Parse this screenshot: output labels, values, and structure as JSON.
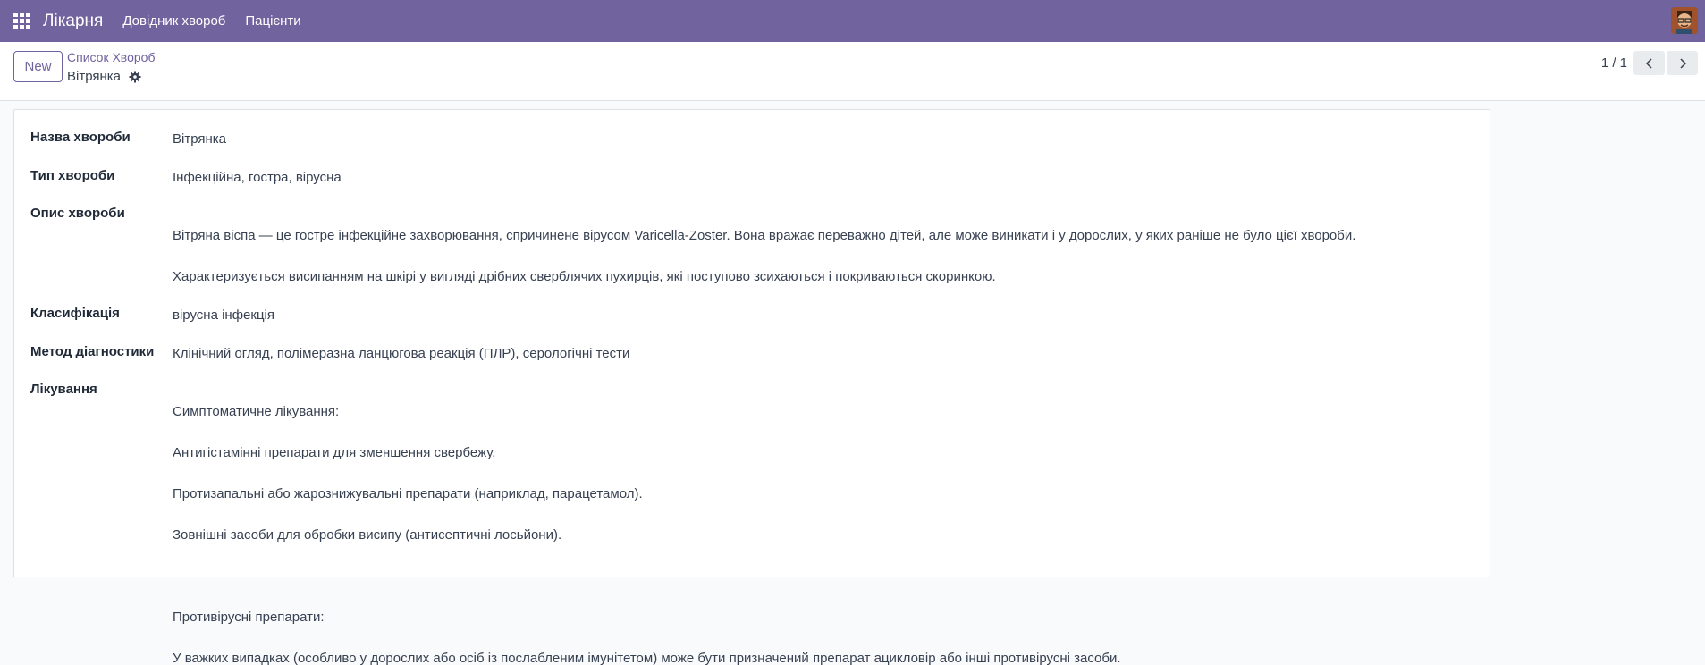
{
  "navbar": {
    "app_title": "Лікарня",
    "menu": [
      "Довідник хвороб",
      "Пацієнти"
    ],
    "bg_color": "#71639e"
  },
  "control": {
    "new_label": "New",
    "breadcrumb_parent": "Список Хвороб",
    "breadcrumb_current": "Вітрянка",
    "pager": "1 / 1"
  },
  "form": {
    "name_label": "Назва хвороби",
    "name_value": "Вітрянка",
    "type_label": "Тип хвороби",
    "type_value": "Інфекційна, гостра, вірусна",
    "desc_label": "Опис хвороби",
    "desc_line1": "Вітряна віспа — це гостре інфекційне захворювання, спричинене вірусом Varicella-Zoster. Вона вражає переважно дітей, але може виникати і у дорослих, у яких раніше не було цієї хвороби.",
    "desc_line2": "Характеризується висипанням на шкірі у вигляді дрібних сверблячих пухирців, які поступово зсихаються і покриваються скоринкою.",
    "class_label": "Класифікація",
    "class_value": "вірусна інфекція",
    "diag_label": "Метод діагностики",
    "diag_value": "Клінічний огляд, полімеразна ланцюгова реакція (ПЛР), серологічні тести",
    "treat_label": "Лікування",
    "treat_lines": [
      "Симптоматичне лікування:",
      "Антигістамінні препарати для зменшення свербежу.",
      "Протизапальні або жарознижувальні препарати (наприклад, парацетамол).",
      "Зовнішні засоби для обробки висипу (антисептичні лосьйони).",
      "",
      "Противірусні препарати:",
      "У важких випадках (особливо у дорослих або осіб із послабленим імунітетом) може бути призначений препарат ацикловір або інші противірусні засоби."
    ]
  }
}
